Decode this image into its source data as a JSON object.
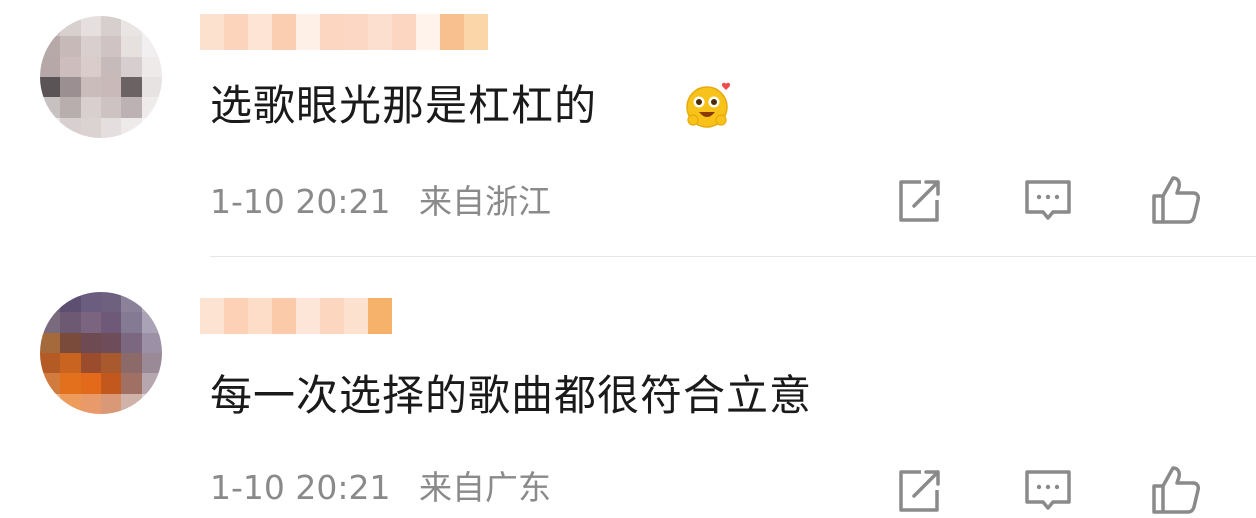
{
  "comments": [
    {
      "text": "选歌眼光那是杠杠的",
      "time": "1-10 20:21",
      "location": "来自浙江",
      "has_emoji": true
    },
    {
      "text": "每一次选择的歌曲都很符合立意",
      "time": "1-10 20:21",
      "location": "来自广东",
      "has_emoji": false
    }
  ],
  "icons": {
    "share": "share-icon",
    "comment": "comment-icon",
    "like": "like-icon"
  },
  "colors": {
    "text": "#1a1a1a",
    "meta": "#8a8a8a",
    "icon": "#8a8a8a",
    "divider": "#e6e6e6"
  }
}
